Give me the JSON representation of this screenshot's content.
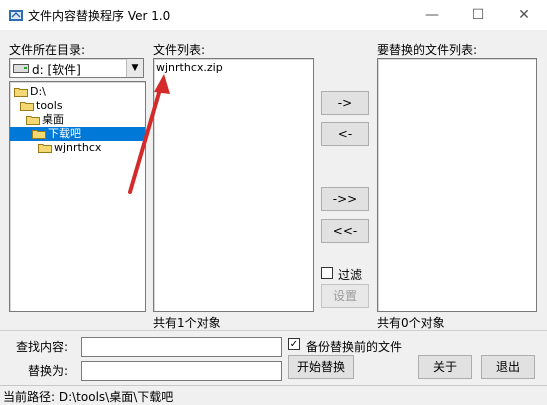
{
  "window": {
    "title": "文件内容替换程序 Ver 1.0",
    "minimize_glyph": "—",
    "maximize_glyph": "☐",
    "close_glyph": "✕"
  },
  "left": {
    "dir_label": "文件所在目录:",
    "drive_value": "d: [软件]",
    "tree": [
      {
        "label": "D:\\",
        "selected": false
      },
      {
        "label": "tools",
        "selected": false
      },
      {
        "label": "桌面",
        "selected": false
      },
      {
        "label": "下载吧",
        "selected": true
      },
      {
        "label": "wjnrthcx",
        "selected": false
      }
    ]
  },
  "middle": {
    "files_label": "文件列表:",
    "files": [
      "wjnrthcx.zip"
    ],
    "count_text": "共有1个对象"
  },
  "buttons": {
    "add": "->",
    "remove": "<-",
    "add_all": "->>",
    "remove_all": "<<-",
    "filter_label": "过滤",
    "settings": "设置"
  },
  "right": {
    "replace_label": "要替换的文件列表:",
    "count_text": "共有0个对象"
  },
  "bottom": {
    "find_label": "查找内容:",
    "replace_label": "替换为:",
    "find_value": "",
    "replace_value": "",
    "backup_label": "备份替换前的文件",
    "backup_checked": "✓",
    "start_button": "开始替换",
    "about_button": "关于",
    "exit_button": "退出"
  },
  "status": {
    "path_text": "当前路径: D:\\tools\\桌面\\下载吧"
  },
  "colors": {
    "selection": "#0078d7",
    "arrow": "#d42a2a"
  }
}
